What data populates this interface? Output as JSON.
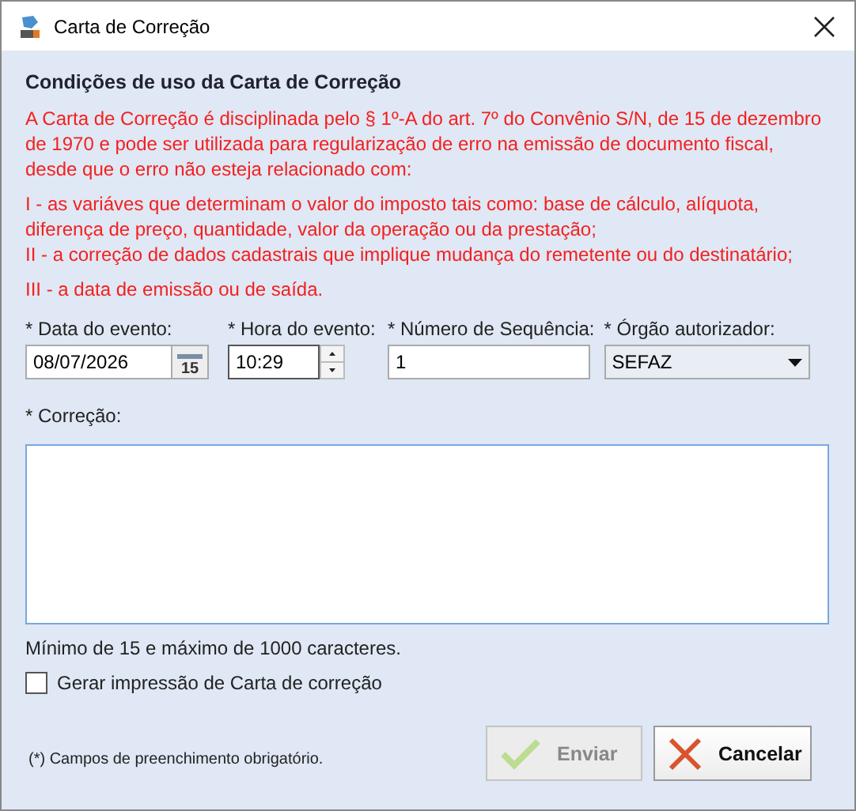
{
  "window": {
    "title": "Carta de Correção"
  },
  "conditions": {
    "title": "Condições de uso da Carta de Correção",
    "paragraphs": [
      [
        "A Carta de Correção é disciplinada pelo § 1º-A do art. 7º do Convênio S/N, de 15 de dezembro de 1970 e pode ser utilizada para regularização de erro na emissão de documento fiscal, desde que o erro não esteja relacionado com:"
      ],
      [
        "I - as variáves que determinam o valor do imposto tais como: base de cálculo, alíquota, diferença de preço, quantidade, valor da operação ou da prestação;",
        "II - a correção de dados cadastrais que implique mudança do remetente ou do destinatário;"
      ],
      [
        "III - a data de emissão ou de saída."
      ]
    ]
  },
  "fields": [
    {
      "kind": "date",
      "label": "* Data do evento:",
      "value": "08/07/2026",
      "calendar_day": "15"
    },
    {
      "kind": "time",
      "label": "* Hora do evento:",
      "value": "10:29"
    },
    {
      "kind": "text",
      "label": "* Número de Sequência:",
      "value": "1"
    },
    {
      "kind": "select",
      "label": "* Órgão autorizador:",
      "value": "SEFAZ"
    }
  ],
  "correction": {
    "label": "* Correção:",
    "hint": "Mínimo de 15 e máximo de 1000 caracteres."
  },
  "print_option": {
    "label": "Gerar impressão de Carta de correção",
    "checked": false
  },
  "footnote": "(*) Campos de preenchimento obrigatório.",
  "buttons": [
    {
      "kind": "send",
      "label": "Enviar",
      "disabled": true
    },
    {
      "kind": "cancel",
      "label": "Cancelar",
      "disabled": false
    }
  ]
}
